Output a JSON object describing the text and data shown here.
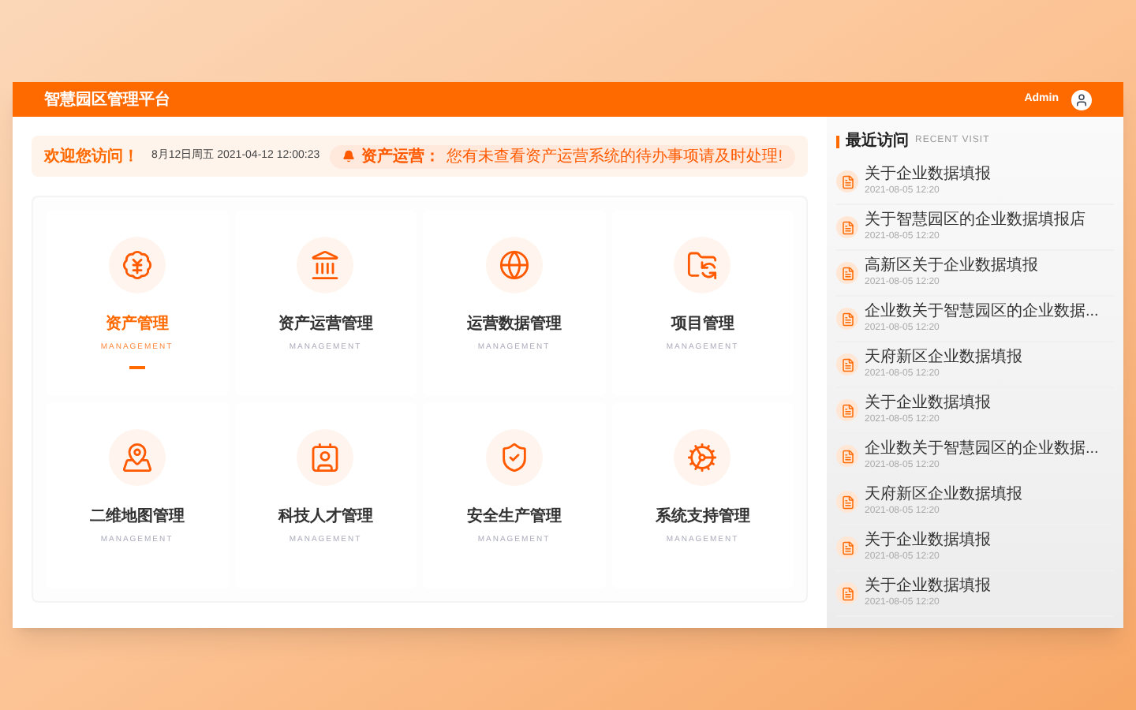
{
  "header": {
    "title": "智慧园区管理平台",
    "user": "Admin"
  },
  "welcome": {
    "greeting": "欢迎您访问！",
    "date": "8月12日周五 2021-04-12 12:00:23",
    "notice_label": "资产运营：",
    "notice_text": "您有未查看资产运营系统的待办事项请及时处理!"
  },
  "modules": [
    {
      "title": "资产管理",
      "subtitle": "MANAGEMENT",
      "selected": true
    },
    {
      "title": "资产运营管理",
      "subtitle": "MANAGEMENT",
      "selected": false
    },
    {
      "title": "运营数据管理",
      "subtitle": "MANAGEMENT",
      "selected": false
    },
    {
      "title": "项目管理",
      "subtitle": "MANAGEMENT",
      "selected": false
    },
    {
      "title": "二维地图管理",
      "subtitle": "MANAGEMENT",
      "selected": false
    },
    {
      "title": "科技人才管理",
      "subtitle": "MANAGEMENT",
      "selected": false
    },
    {
      "title": "安全生产管理",
      "subtitle": "MANAGEMENT",
      "selected": false
    },
    {
      "title": "系统支持管理",
      "subtitle": "MANAGEMENT",
      "selected": false
    }
  ],
  "recent": {
    "title": "最近访问",
    "subtitle": "RECENT VISIT",
    "items": [
      {
        "title": "关于企业数据填报",
        "time": "2021-08-05 12:20"
      },
      {
        "title": "关于智慧园区的企业数据填报店",
        "time": "2021-08-05 12:20"
      },
      {
        "title": "高新区关于企业数据填报",
        "time": "2021-08-05 12:20"
      },
      {
        "title": "企业数关于智慧园区的企业数据...",
        "time": "2021-08-05 12:20"
      },
      {
        "title": "天府新区企业数据填报",
        "time": "2021-08-05 12:20"
      },
      {
        "title": "关于企业数据填报",
        "time": "2021-08-05 12:20"
      },
      {
        "title": "企业数关于智慧园区的企业数据...",
        "time": "2021-08-05 12:20"
      },
      {
        "title": "天府新区企业数据填报",
        "time": "2021-08-05 12:20"
      },
      {
        "title": "关于企业数据填报",
        "time": "2021-08-05 12:20"
      },
      {
        "title": "关于企业数据填报",
        "time": "2021-08-05 12:20"
      }
    ]
  }
}
